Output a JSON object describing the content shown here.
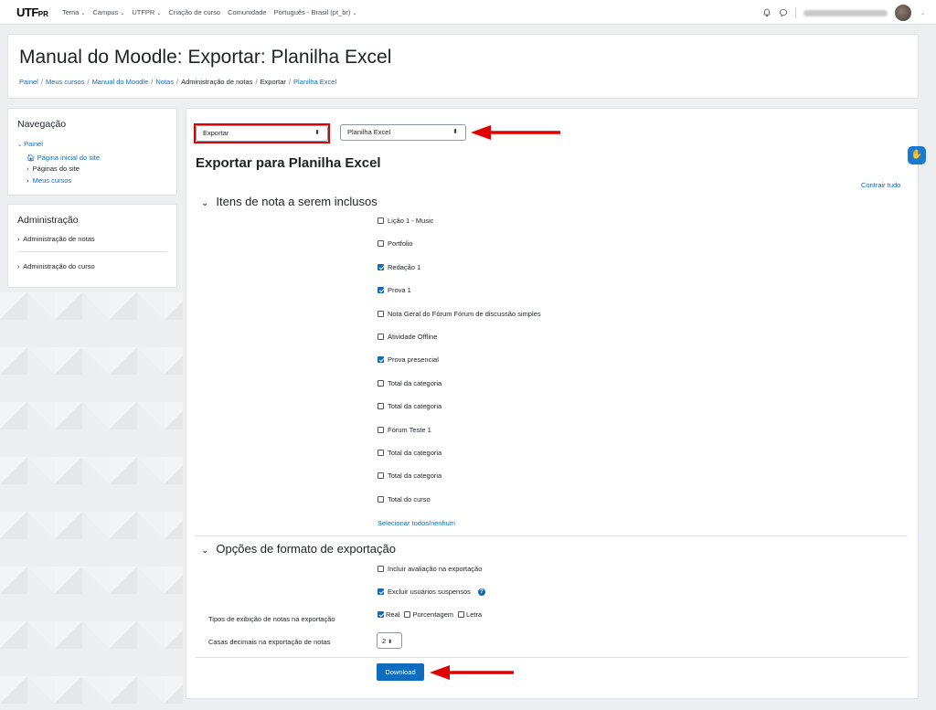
{
  "navbar": {
    "logo_main": "UTF",
    "logo_small": "PR",
    "links": [
      "Tema",
      "Campus",
      "UTFPR",
      "Criação de curso",
      "Comunidade",
      "Português - Brasil (pt_br)"
    ],
    "bell_icon": "bell-icon",
    "chat_icon": "chat-icon"
  },
  "header": {
    "title": "Manual do Moodle: Exportar: Planilha Excel",
    "breadcrumb": [
      "Painel",
      "Meus cursos",
      "Manual do Moodle",
      "Notas",
      "Administração de notas",
      "Exportar",
      "Planilha Excel"
    ]
  },
  "nav_block": {
    "title": "Navegação",
    "painel": "Painel",
    "pagina_inicial": "Página inicial do site",
    "paginas": "Páginas do site",
    "meus_cursos": "Meus cursos"
  },
  "admin_block": {
    "title": "Administração",
    "items": [
      "Administração de notas",
      "Administração do curso"
    ]
  },
  "main": {
    "select_action": "Exportar",
    "select_format": "Planilha Excel",
    "heading": "Exportar para Planilha Excel",
    "collapse_all": "Contrair tudo",
    "section_items": "Itens de nota a serem inclusos",
    "grade_items": [
      {
        "label": "Lição 1 - Music",
        "checked": false
      },
      {
        "label": "Portfolio",
        "checked": false
      },
      {
        "label": "Redação 1",
        "checked": true
      },
      {
        "label": "Prova 1",
        "checked": true
      },
      {
        "label": "Nota Geral do Fórum Fórum de discussão simples",
        "checked": false
      },
      {
        "label": "Atividade Offline",
        "checked": false
      },
      {
        "label": "Prova presencial",
        "checked": true
      },
      {
        "label": "Total da categoria",
        "checked": false
      },
      {
        "label": "Total da categoria",
        "checked": false
      },
      {
        "label": "Fórum Teste 1",
        "checked": false
      },
      {
        "label": "Total da categoria",
        "checked": false
      },
      {
        "label": "Total da categoria",
        "checked": false
      },
      {
        "label": "Total do curso",
        "checked": false
      }
    ],
    "select_all": "Selecionar todos/nenhum",
    "section_options": "Opções de formato de exportação",
    "opt_include_feedback": "Incluir avaliação na exportação",
    "opt_exclude_suspended": "Excluir usuários suspensos",
    "display_types_label": "Tipos de exibição de notas na exportação",
    "display_types": [
      {
        "label": "Real",
        "checked": true
      },
      {
        "label": "Porcentagem",
        "checked": false
      },
      {
        "label": "Letra",
        "checked": false
      }
    ],
    "decimals_label": "Casas decimais na exportação de notas",
    "decimals_value": "2",
    "download": "Download"
  },
  "colors": {
    "accent": "#0f6cbf",
    "annotation_red": "#e00000"
  }
}
